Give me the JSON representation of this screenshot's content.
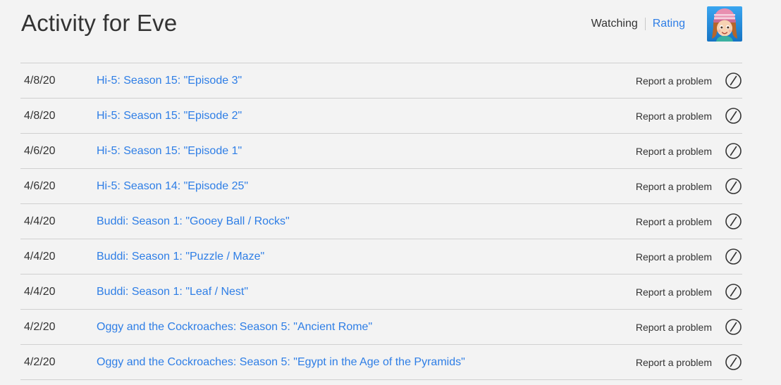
{
  "header": {
    "title": "Activity for Eve",
    "tabs": [
      {
        "label": "Watching",
        "active": false
      },
      {
        "label": "Rating",
        "active": true
      }
    ]
  },
  "colors": {
    "background": "#f3f3f3",
    "link": "#2e7ee6",
    "text": "#333333",
    "divider": "#d0d0d0"
  },
  "activity": {
    "report_label": "Report a problem",
    "hide_icon": "hide-from-history-icon",
    "rows": [
      {
        "date": "4/8/20",
        "title": "Hi-5: Season 15: \"Episode 3\""
      },
      {
        "date": "4/8/20",
        "title": "Hi-5: Season 15: \"Episode 2\""
      },
      {
        "date": "4/6/20",
        "title": "Hi-5: Season 15: \"Episode 1\""
      },
      {
        "date": "4/6/20",
        "title": "Hi-5: Season 14: \"Episode 25\""
      },
      {
        "date": "4/4/20",
        "title": "Buddi: Season 1: \"Gooey Ball / Rocks\""
      },
      {
        "date": "4/4/20",
        "title": "Buddi: Season 1: \"Puzzle / Maze\""
      },
      {
        "date": "4/4/20",
        "title": "Buddi: Season 1: \"Leaf / Nest\""
      },
      {
        "date": "4/2/20",
        "title": "Oggy and the Cockroaches: Season 5: \"Ancient Rome\""
      },
      {
        "date": "4/2/20",
        "title": "Oggy and the Cockroaches: Season 5: \"Egypt in the Age of the Pyramids\""
      }
    ]
  }
}
